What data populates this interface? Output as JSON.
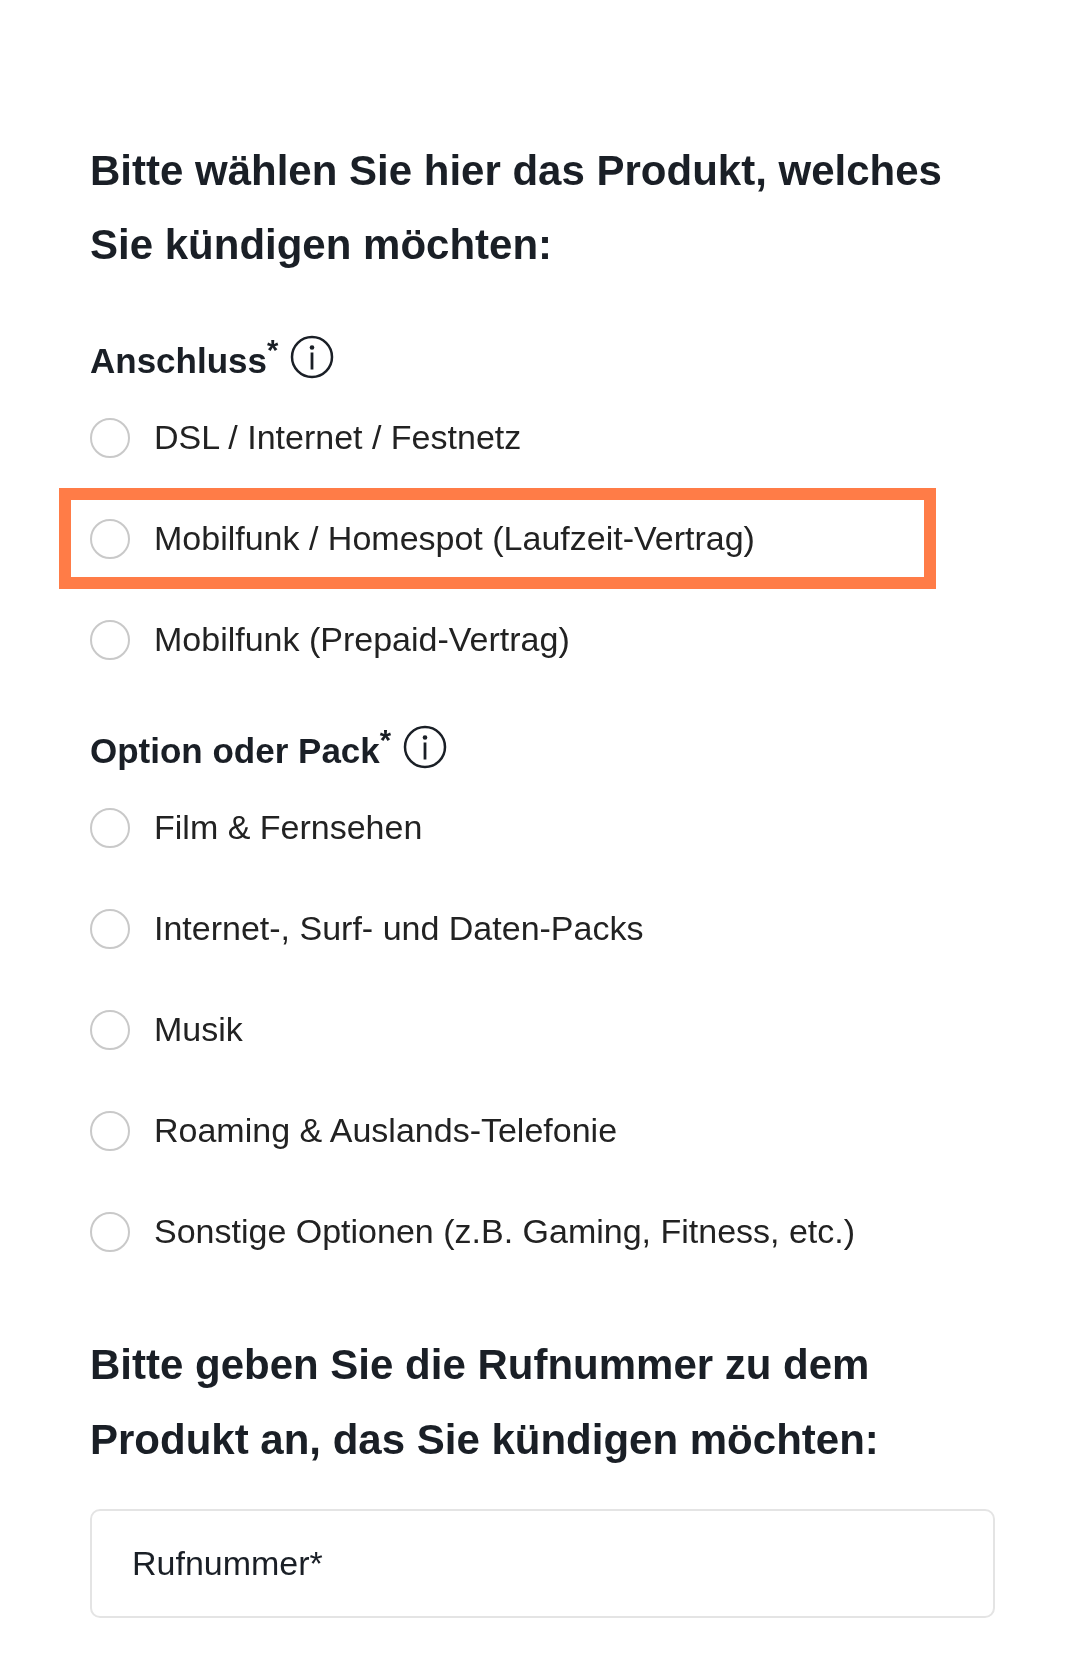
{
  "heading": "Bitte wählen Sie hier das Produkt, welches Sie kündigen möchten:",
  "groups": [
    {
      "label": "Anschluss$^{*}$",
      "options": [
        {
          "label": "DSL / Internet / Festnetz",
          "selected": false,
          "highlighted": false
        },
        {
          "label": "Mobilfunk / Homespot (Laufzeit-Vertrag)",
          "selected": false,
          "highlighted": true
        },
        {
          "label": "Mobilfunk (Prepaid-Vertrag)",
          "selected": false,
          "highlighted": false
        }
      ]
    },
    {
      "label": "Option oder Pack$^{*}$",
      "options": [
        {
          "label": "Film & Fernsehen",
          "selected": false,
          "highlighted": false
        },
        {
          "label": "Internet-, Surf- und Daten-Packs",
          "selected": false,
          "highlighted": false
        },
        {
          "label": "Musik",
          "selected": false,
          "highlighted": false
        },
        {
          "label": "Roaming & Auslands-Telefonie",
          "selected": false,
          "highlighted": false
        },
        {
          "label": "Sonstige Optionen (z.B. Gaming, Fitness, etc.)",
          "selected": false,
          "highlighted": false
        }
      ]
    }
  ],
  "phone_heading": "Bitte geben Sie die Rufnummer zu dem Produkt an, das Sie kündigen möchten:",
  "phone_field": {
    "placeholder": "Rufnummer*"
  }
}
